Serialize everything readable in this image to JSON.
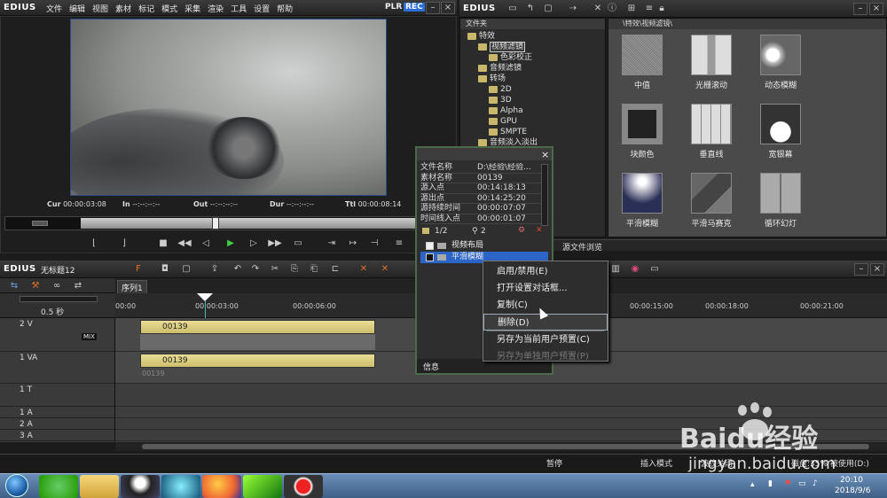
{
  "app": {
    "logo": "EDIUS",
    "mode_plr": "PLR",
    "mode_rec": "REC"
  },
  "menu": [
    "文件",
    "编辑",
    "视图",
    "素材",
    "标记",
    "模式",
    "采集",
    "渲染",
    "工具",
    "设置",
    "帮助"
  ],
  "player": {
    "cur_label": "Cur",
    "cur_value": "00:00:03:08",
    "in_label": "In",
    "in_value": "--:--:--:--",
    "out_label": "Out",
    "out_value": "--:--:--:--",
    "dur_label": "Dur",
    "dur_value": "--:--:--:--",
    "ttl_label": "Ttl",
    "ttl_value": "00:00:08:14"
  },
  "bin": {
    "logo": "EDIUS",
    "folder_header": "文件夹",
    "path": "\\特效\\视频滤镜\\",
    "tree": [
      {
        "label": "特效",
        "indent": 0
      },
      {
        "label": "视频滤镜",
        "indent": 1,
        "selected": true
      },
      {
        "label": "色彩校正",
        "indent": 2
      },
      {
        "label": "音频滤镜",
        "indent": 1
      },
      {
        "label": "转场",
        "indent": 1
      },
      {
        "label": "2D",
        "indent": 2
      },
      {
        "label": "3D",
        "indent": 2
      },
      {
        "label": "Alpha",
        "indent": 2
      },
      {
        "label": "GPU",
        "indent": 2
      },
      {
        "label": "SMPTE",
        "indent": 2
      },
      {
        "label": "音频淡入淡出",
        "indent": 1
      }
    ],
    "effects": [
      {
        "label": "中值"
      },
      {
        "label": "光栅滚动"
      },
      {
        "label": "动态模糊"
      },
      {
        "label": "块颜色"
      },
      {
        "label": "垂直线"
      },
      {
        "label": "宽银幕"
      },
      {
        "label": "平滑模糊"
      },
      {
        "label": "平滑马赛克"
      },
      {
        "label": "循环幻灯"
      }
    ],
    "bottom_tab": "源文件浏览"
  },
  "info": {
    "rows": [
      {
        "k": "文件名称",
        "v": "D:\\经验\\经验..."
      },
      {
        "k": "素材名称",
        "v": "00139"
      },
      {
        "k": "源入点",
        "v": "00:14:18:13"
      },
      {
        "k": "源出点",
        "v": "00:14:25:20"
      },
      {
        "k": "源持续时间",
        "v": "00:00:07:07"
      },
      {
        "k": "时间线入点",
        "v": "00:00:01:07"
      }
    ],
    "page": "1/2",
    "count": "2",
    "layers": [
      {
        "label": "视频布局",
        "checked": true
      },
      {
        "label": "平滑模糊",
        "checked": false
      }
    ],
    "tab": "信息"
  },
  "context_menu": [
    {
      "label": "启用/禁用(E)",
      "disabled": false,
      "separator_after": false
    },
    {
      "label": "打开设置对话框...",
      "disabled": false,
      "separator_after": false
    },
    {
      "label": "复制(C)",
      "disabled": false,
      "separator_after": false
    },
    {
      "label": "删除(D)",
      "disabled": false,
      "separator_after": true,
      "hover": true
    },
    {
      "label": "另存为当前用户预置(C)",
      "disabled": false,
      "separator_after": false
    },
    {
      "label": "另存为单独用户预置(P)",
      "disabled": true,
      "separator_after": false
    }
  ],
  "timeline": {
    "logo": "EDIUS",
    "project": "无标题12",
    "sequence_tab": "序列1",
    "zoom": "0.5 秒",
    "ruler": [
      "00:00",
      "00:00:03:00",
      "00:00:06:00",
      "00:00:15:00",
      "00:00:18:00",
      "00:00:21:00"
    ],
    "tracks": [
      {
        "label": "2 V",
        "clip": "00139",
        "mix": "MIX"
      },
      {
        "label": "1 VA",
        "clip": "00139",
        "sub": "00139"
      },
      {
        "label": "1 T"
      },
      {
        "label": "1 A"
      },
      {
        "label": "2 A"
      },
      {
        "label": "3 A"
      }
    ]
  },
  "statusbar": {
    "pause": "暂停",
    "insert_mode": "插入模式",
    "ripple": "波纹关闭",
    "disk": "磁盘:35% 被使用(D:)"
  },
  "taskbar": {
    "time": "20:10",
    "date": "2018/9/6"
  },
  "watermark": {
    "brand": "Baidu经验",
    "url": "jingyan.baidu.com"
  }
}
